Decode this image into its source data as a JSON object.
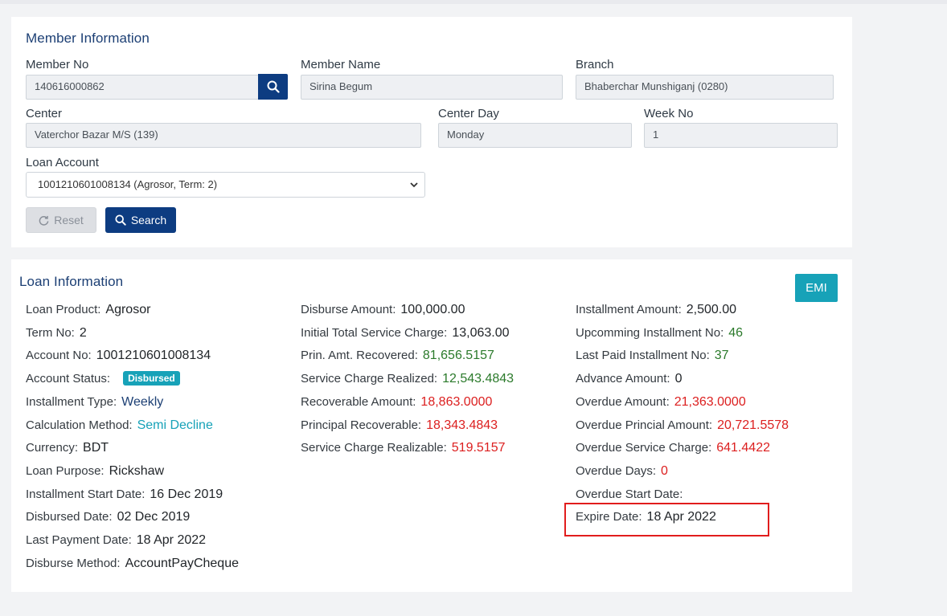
{
  "member": {
    "title": "Member Information",
    "member_no_label": "Member No",
    "member_no_value": "140616000862",
    "member_name_label": "Member Name",
    "member_name_value": "Sirina Begum",
    "branch_label": "Branch",
    "branch_value": "Bhaberchar Munshiganj (0280)",
    "center_label": "Center",
    "center_value": "Vaterchor Bazar M/S (139)",
    "center_day_label": "Center Day",
    "center_day_value": "Monday",
    "week_no_label": "Week No",
    "week_no_value": "1",
    "loan_account_label": "Loan Account",
    "loan_account_selected": "1001210601008134 (Agrosor, Term: 2)",
    "reset_label": "Reset",
    "search_label": "Search"
  },
  "loan": {
    "title": "Loan Information",
    "emi_label": "EMI",
    "col1": [
      {
        "label": "Loan Product:",
        "value": "Agrosor",
        "style": ""
      },
      {
        "label": "Term No:",
        "value": "2",
        "style": ""
      },
      {
        "label": "Account No:",
        "value": "1001210601008134",
        "style": ""
      },
      {
        "label": "Account Status:",
        "value": "Disbursed",
        "style": "badge"
      },
      {
        "label": "Installment Type:",
        "value": "Weekly",
        "style": "navy"
      },
      {
        "label": "Calculation Method:",
        "value": "Semi Decline",
        "style": "teal"
      },
      {
        "label": "Currency:",
        "value": "BDT",
        "style": ""
      },
      {
        "label": "Loan Purpose:",
        "value": "Rickshaw",
        "style": ""
      },
      {
        "label": "Installment Start Date:",
        "value": "16 Dec 2019",
        "style": ""
      },
      {
        "label": "Disbursed Date:",
        "value": "02 Dec 2019",
        "style": ""
      },
      {
        "label": "Last Payment Date:",
        "value": "18 Apr 2022",
        "style": ""
      },
      {
        "label": "Disburse Method:",
        "value": "AccountPayCheque",
        "style": ""
      }
    ],
    "col2": [
      {
        "label": "Disburse Amount:",
        "value": "100,000.00",
        "style": ""
      },
      {
        "label": "Initial Total Service Charge:",
        "value": "13,063.00",
        "style": ""
      },
      {
        "label": "Prin. Amt. Recovered:",
        "value": "81,656.5157",
        "style": "green"
      },
      {
        "label": "Service Charge Realized:",
        "value": "12,543.4843",
        "style": "green"
      },
      {
        "label": "Recoverable Amount:",
        "value": "18,863.0000",
        "style": "red"
      },
      {
        "label": "Principal Recoverable:",
        "value": "18,343.4843",
        "style": "red"
      },
      {
        "label": "Service Charge Realizable:",
        "value": "519.5157",
        "style": "red"
      }
    ],
    "col3": [
      {
        "label": "Installment Amount:",
        "value": "2,500.00",
        "style": ""
      },
      {
        "label": "Upcomming Installment No:",
        "value": "46",
        "style": "green"
      },
      {
        "label": "Last Paid Installment No:",
        "value": "37",
        "style": "green"
      },
      {
        "label": "Advance Amount:",
        "value": "0",
        "style": ""
      },
      {
        "label": "Overdue Amount:",
        "value": "21,363.0000",
        "style": "red"
      },
      {
        "label": "Overdue Princial Amount:",
        "value": "20,721.5578",
        "style": "red"
      },
      {
        "label": "Overdue Service Charge:",
        "value": "641.4422",
        "style": "red"
      },
      {
        "label": "Overdue Days:",
        "value": "0",
        "style": "red"
      },
      {
        "label": "Overdue Start Date:",
        "value": "",
        "style": ""
      },
      {
        "label": "Expire Date:",
        "value": "18 Apr 2022",
        "style": ""
      }
    ]
  }
}
